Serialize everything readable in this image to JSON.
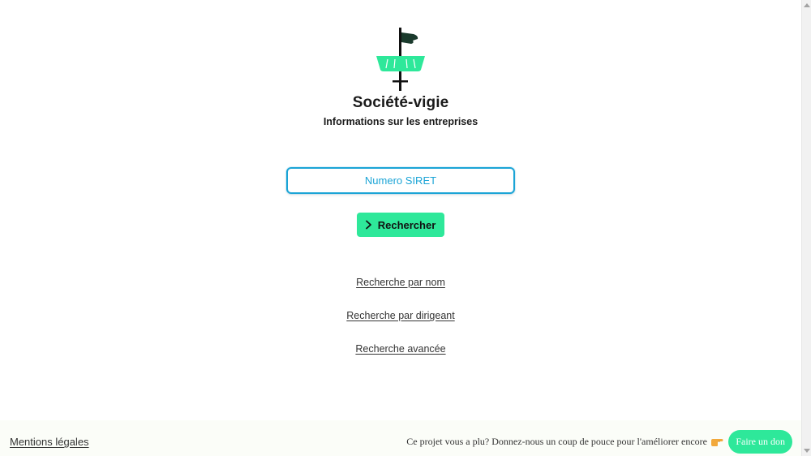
{
  "brand": {
    "title": "Société-vigie",
    "subtitle": "Informations sur les entreprises"
  },
  "search": {
    "placeholder": "Numero SIRET",
    "value": "",
    "button_label": "Rechercher"
  },
  "links": [
    {
      "label": "Recherche par nom"
    },
    {
      "label": "Recherche par dirigeant"
    },
    {
      "label": "Recherche avancée"
    }
  ],
  "footer": {
    "legal_label": "Mentions légales",
    "promo_text": "Ce projet vous a plu? Donnez-nous un coup de pouce pour l'améliorer encore",
    "donate_label": "Faire un don"
  },
  "colors": {
    "accent": "#2ee89a",
    "input_border": "#1ba4d6",
    "text": "#1a1a1a"
  },
  "icons": {
    "logo": "watchtower-flag-logo",
    "button": "chevron-right-icon",
    "promo": "pointing-right-hand-icon"
  }
}
